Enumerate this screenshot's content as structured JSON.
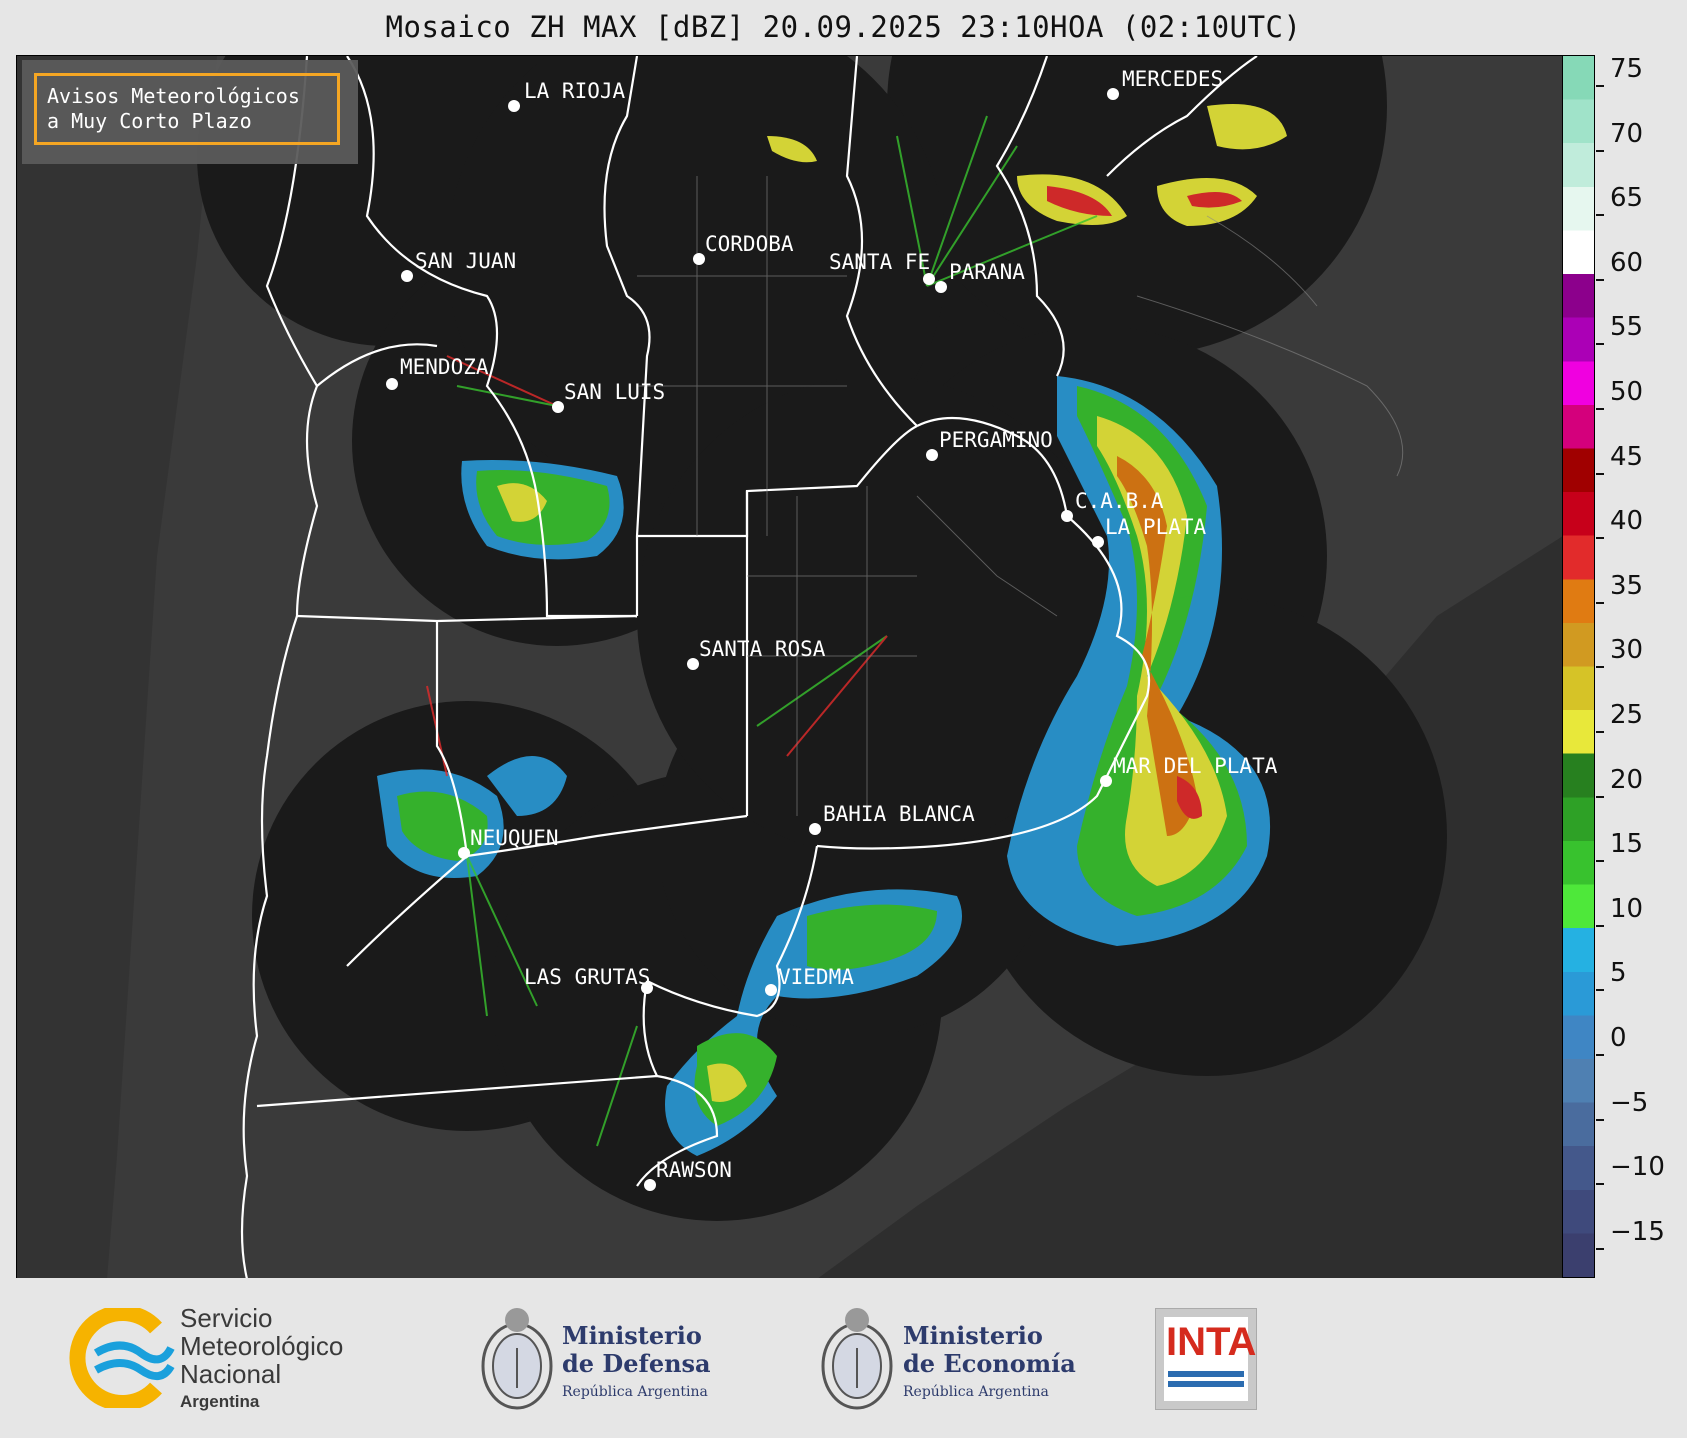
{
  "title": "Mosaico ZH MAX [dBZ] 20.09.2025 23:10HOA (02:10UTC)",
  "notice": {
    "line1": "Avisos Meteorológicos",
    "line2": "a Muy Corto Plazo"
  },
  "colorbar": {
    "unit": "dBZ",
    "ticks": [
      "75",
      "70",
      "65",
      "60",
      "55",
      "50",
      "45",
      "40",
      "35",
      "30",
      "25",
      "20",
      "15",
      "10",
      "5",
      "0",
      "−5",
      "−10",
      "−15"
    ],
    "colors": [
      "#3b3f6e",
      "#3f4a7c",
      "#44588b",
      "#4a6c9e",
      "#4f80b2",
      "#3f86c4",
      "#2a9ad7",
      "#25b1e2",
      "#4ee83a",
      "#38c22e",
      "#2ea126",
      "#27801f",
      "#e8e83a",
      "#d6c327",
      "#d19a21",
      "#e07b12",
      "#e22b2b",
      "#c7001a",
      "#a00000",
      "#d4007c",
      "#f000e0",
      "#ab00b6",
      "#8c008c",
      "#ffffff",
      "#e6f7ef",
      "#c0ecdb",
      "#a0e3c9",
      "#86d9b7"
    ],
    "accent_orange": "#f5a623"
  },
  "cities": [
    {
      "name": "LA RIOJA"
    },
    {
      "name": "MERCEDES"
    },
    {
      "name": "SAN JUAN"
    },
    {
      "name": "CORDOBA"
    },
    {
      "name": "SANTA FE"
    },
    {
      "name": "PARANA"
    },
    {
      "name": "MENDOZA"
    },
    {
      "name": "SAN LUIS"
    },
    {
      "name": "PERGAMINO"
    },
    {
      "name": "C.A.B.A"
    },
    {
      "name": "LA PLATA"
    },
    {
      "name": "SANTA ROSA"
    },
    {
      "name": "MAR DEL PLATA"
    },
    {
      "name": "BAHIA BLANCA"
    },
    {
      "name": "NEUQUEN"
    },
    {
      "name": "LAS GRUTAS"
    },
    {
      "name": "VIEDMA"
    },
    {
      "name": "RAWSON"
    }
  ],
  "footer": {
    "smn": {
      "line1": "Servicio",
      "line2": "Meteorológico",
      "line3": "Nacional",
      "line4": "Argentina"
    },
    "defensa": {
      "line1": "Ministerio",
      "line2": "de Defensa",
      "line3": "República Argentina"
    },
    "economia": {
      "line1": "Ministerio",
      "line2": "de Economía",
      "line3": "República Argentina"
    },
    "inta": {
      "label": "INTA"
    }
  }
}
